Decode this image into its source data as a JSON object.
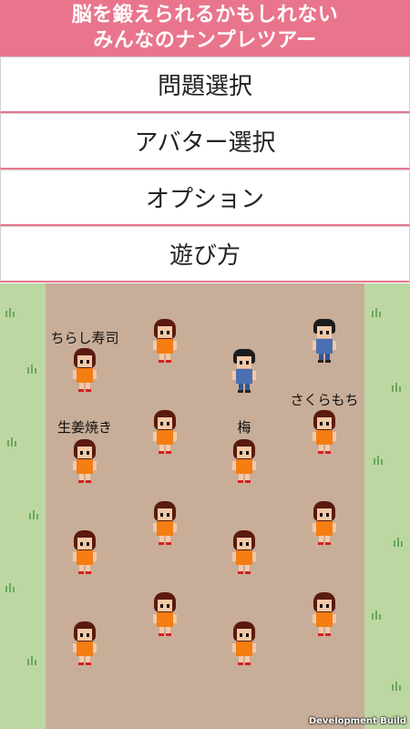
{
  "header": {
    "title_line1": "脳を鍛えられるかもしれない",
    "title_line2": "みんなのナンプレツアー"
  },
  "menu": {
    "items": [
      {
        "label": "問題選択"
      },
      {
        "label": "アバター選択"
      },
      {
        "label": "オプション"
      },
      {
        "label": "遊び方"
      }
    ]
  },
  "players": [
    {
      "name": "ちらし寿司"
    },
    {
      "name": "生姜焼き"
    },
    {
      "name": "梅"
    },
    {
      "name": "さくらもち"
    }
  ],
  "footer": {
    "build_label": "Development Build"
  },
  "colors": {
    "header": "#e9758d",
    "ground": "#c8ad98",
    "grass": "#bdd7a3",
    "avatar_shirt": "#f57d12",
    "boy_shirt": "#4a6fb3"
  }
}
